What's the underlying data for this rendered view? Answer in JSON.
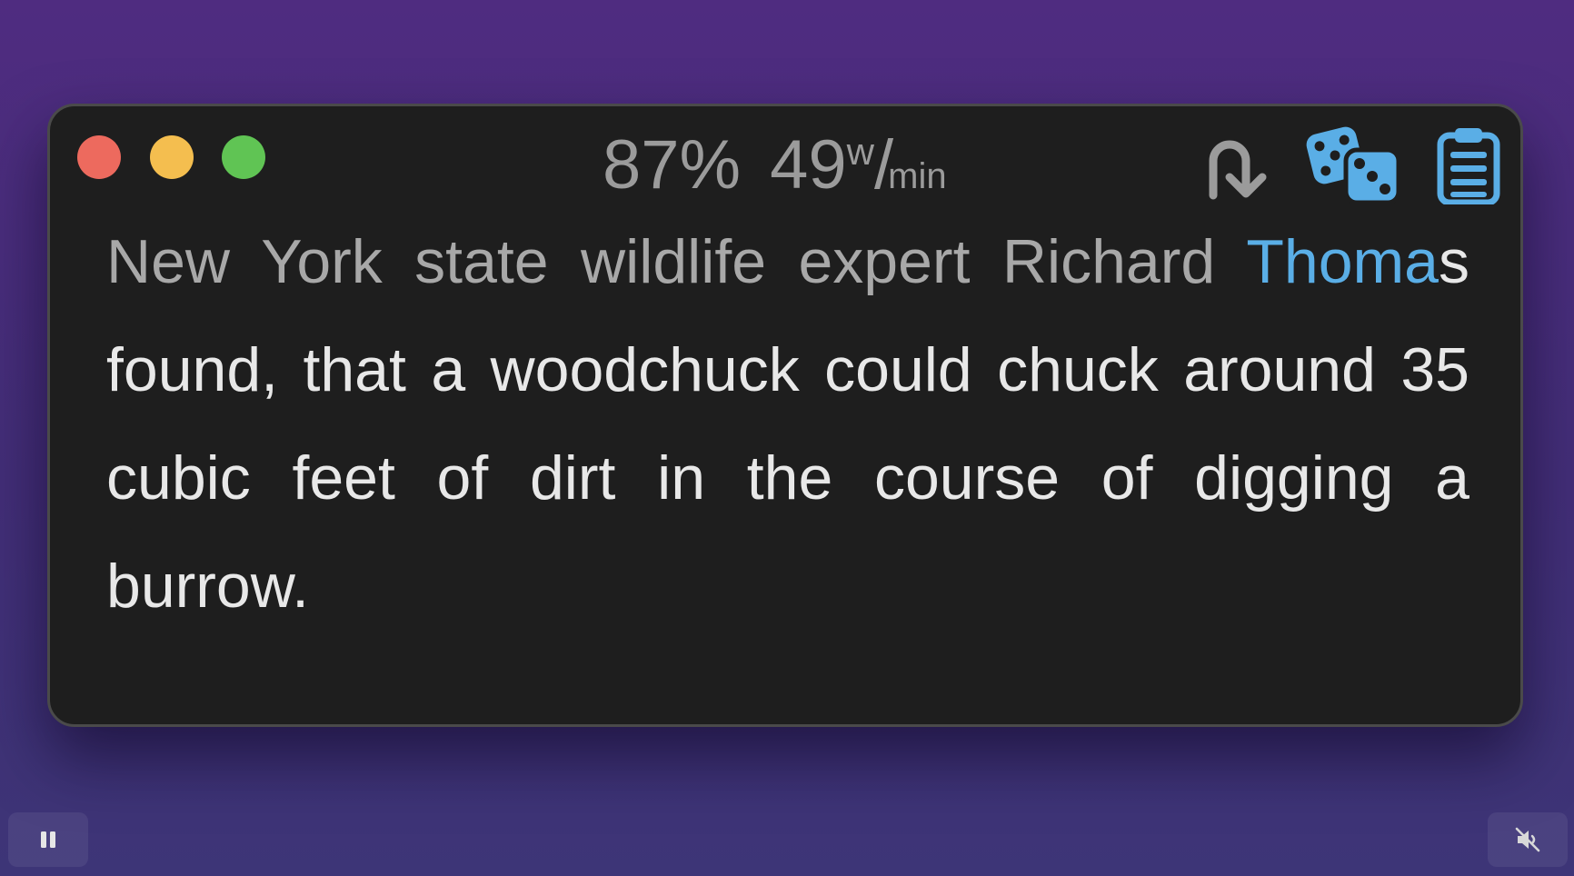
{
  "window": {
    "title": "",
    "controls": {
      "close_icon": "close-icon",
      "minimize_icon": "minimize-icon",
      "zoom_icon": "zoom-icon"
    },
    "colors": {
      "close": "#ed6a5e",
      "minimize": "#f4be4f",
      "zoom": "#60c454"
    }
  },
  "stats": {
    "progress": "87%",
    "progress_value": 0.87,
    "speed_number": "49",
    "speed_sup": "w",
    "speed_slash": "/",
    "speed_unit": "min"
  },
  "toolbar": {
    "rewind_icon": "rewind-arrow-icon",
    "random_icon": "dice-icon",
    "clipboard_icon": "clipboard-icon",
    "accent_color": "#5aaee6"
  },
  "reader": {
    "read_text": "New York state wildlife expert Richard ",
    "current_text": "Thoma",
    "remaining_text": "s found, that a woodchuck could chuck around 35 cubic feet of dirt in the course of digging a burrow.",
    "colors": {
      "read": "#a8a8a8",
      "current": "#5aaee6",
      "remaining": "#e8e8e8"
    }
  },
  "player": {
    "pause_icon": "pause-icon",
    "mute_icon": "muted-speaker-icon"
  }
}
